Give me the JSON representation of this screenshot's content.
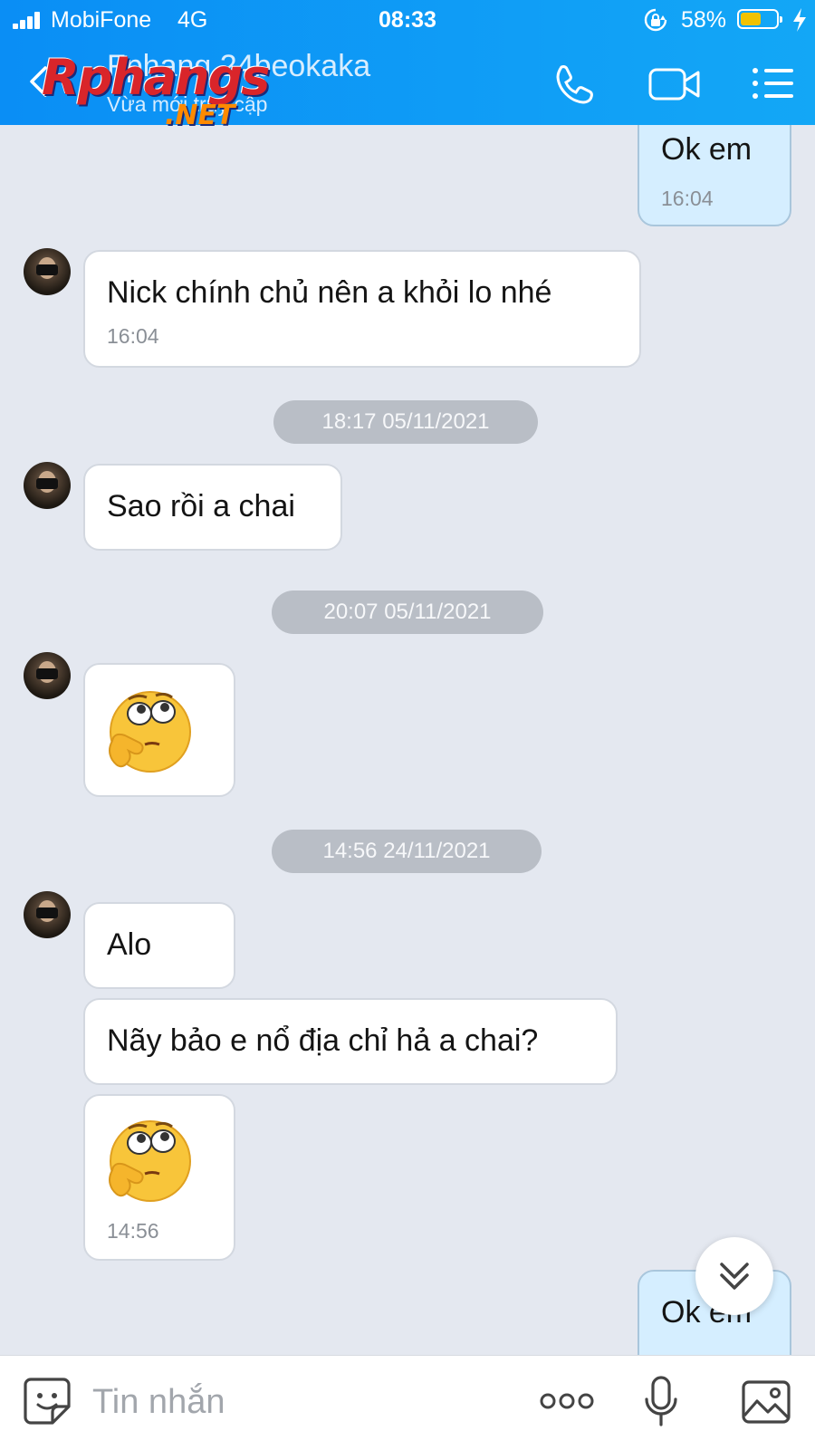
{
  "status_bar": {
    "carrier": "MobiFone",
    "network": "4G",
    "time": "08:33",
    "battery": "58%",
    "battery_level": 0.58
  },
  "header": {
    "contact_name": "Fphang.24beokaka",
    "contact_status": "Vừa mới truy cập",
    "watermark_main": "Rphangs",
    "watermark_net": ".NET"
  },
  "messages": [
    {
      "side": "out",
      "text": "Ok em",
      "time": "16:04"
    },
    {
      "side": "in",
      "text": "Nick chính chủ nên a khỏi lo nhé",
      "time": "16:04"
    },
    {
      "type": "date",
      "text": "18:17 05/11/2021"
    },
    {
      "side": "in",
      "text": "Sao rồi a chai"
    },
    {
      "type": "date",
      "text": "20:07 05/11/2021"
    },
    {
      "side": "in",
      "sticker": "thinking-face"
    },
    {
      "type": "date",
      "text": "14:56 24/11/2021"
    },
    {
      "side": "in",
      "text": "Alo"
    },
    {
      "side": "in",
      "text": "Nãy bảo e nổ địa chỉ hả a chai?"
    },
    {
      "side": "in",
      "sticker": "thinking-face",
      "time": "14:56"
    },
    {
      "side": "out",
      "text": "Ok em"
    }
  ],
  "input": {
    "placeholder": "Tin nhắn"
  },
  "colors": {
    "header": "#0a8ef5",
    "chat_background": "#e4e8f0",
    "outgoing_bubble": "#d5eeff",
    "incoming_bubble": "#ffffff"
  }
}
